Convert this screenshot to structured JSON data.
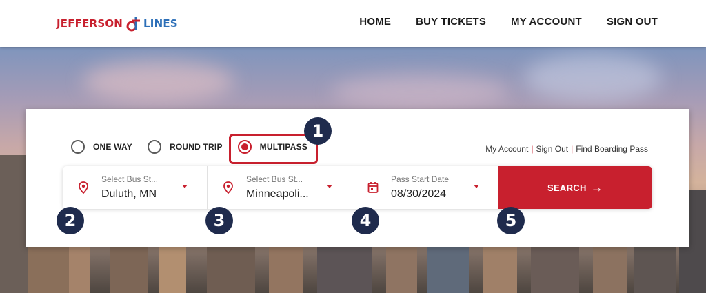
{
  "logo": {
    "left": "JEFFERSON",
    "right": "LINES"
  },
  "nav": {
    "home": "HOME",
    "buy_tickets": "BUY TICKETS",
    "my_account": "MY ACCOUNT",
    "sign_out": "SIGN OUT"
  },
  "trip_types": [
    {
      "label": "ONE WAY",
      "selected": false
    },
    {
      "label": "ROUND TRIP",
      "selected": false
    },
    {
      "label": "MULTIPASS",
      "selected": true
    }
  ],
  "account_links": {
    "my_account": "My Account",
    "sign_out": "Sign Out",
    "find_pass": "Find Boarding Pass",
    "separator": "|"
  },
  "fields": {
    "origin": {
      "placeholder": "Select Bus St...",
      "value": "Duluth, MN",
      "icon": "location-pin-icon"
    },
    "destination": {
      "placeholder": "Select Bus St...",
      "value": "Minneapoli...",
      "icon": "location-pin-icon"
    },
    "start_date": {
      "placeholder": "Pass Start Date",
      "value": "08/30/2024",
      "icon": "calendar-icon"
    }
  },
  "search_button": {
    "label": "SEARCH",
    "arrow": "→"
  },
  "step_badges": [
    "1",
    "2",
    "3",
    "4",
    "5"
  ],
  "colors": {
    "brand_red": "#c8202e",
    "brand_blue": "#2c6fb8",
    "badge_navy": "#1f2b4d"
  }
}
